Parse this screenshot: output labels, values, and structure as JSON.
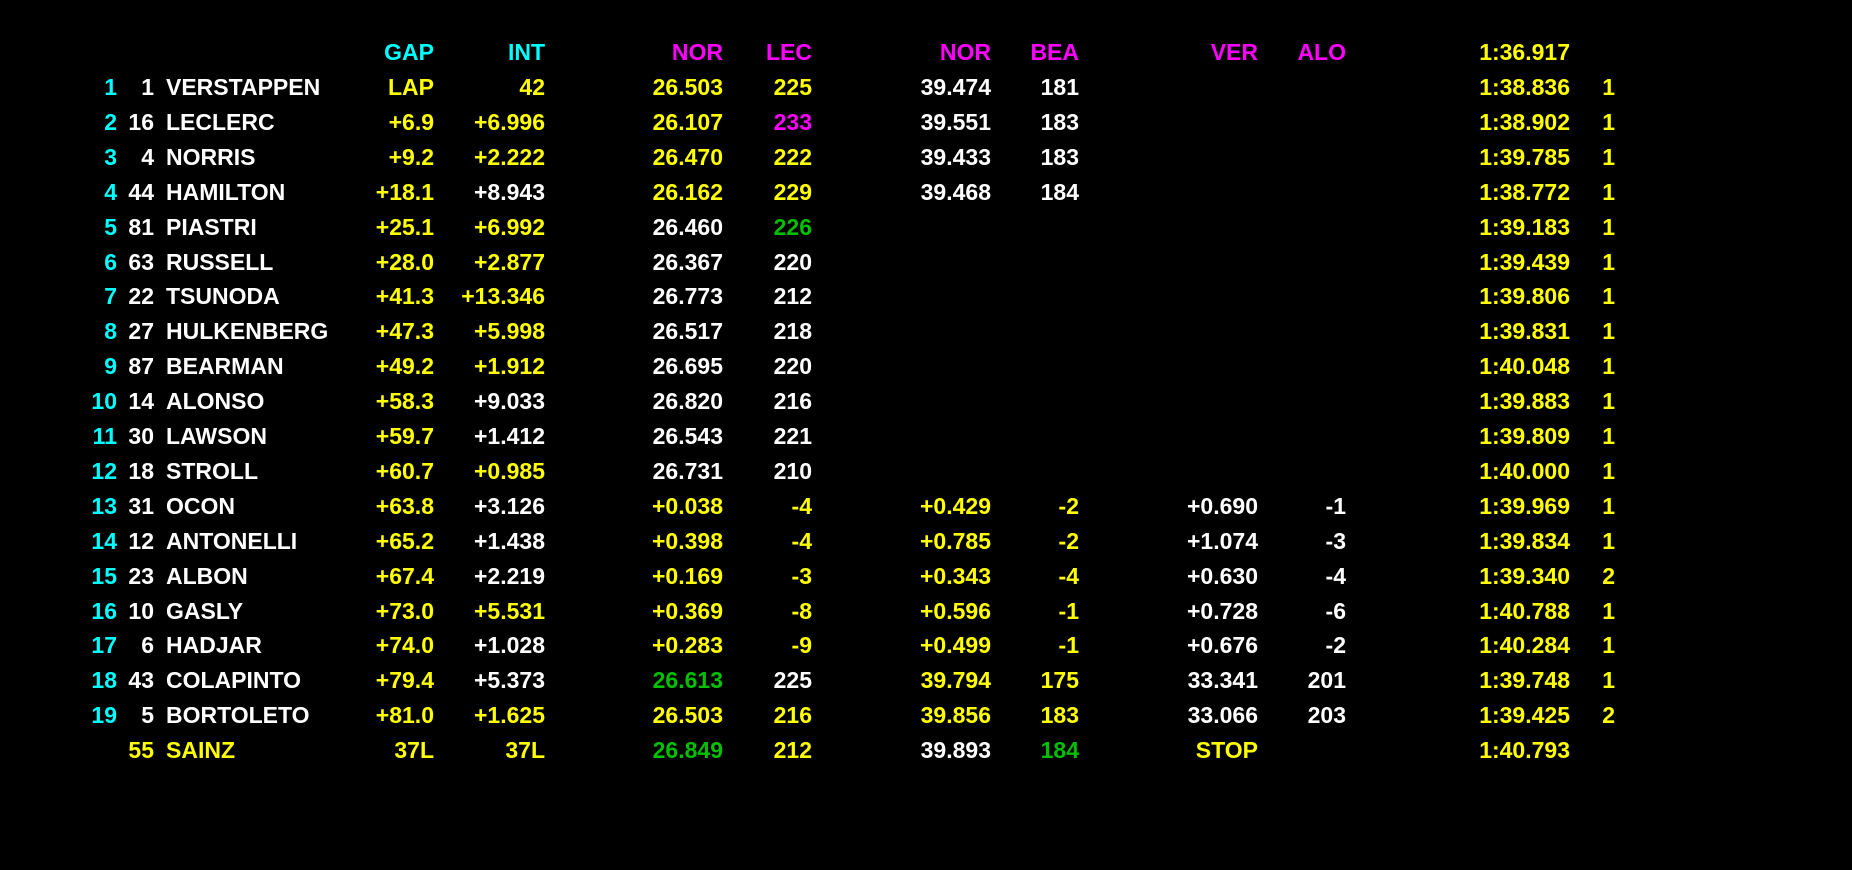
{
  "colors": {
    "white": "#ffffff",
    "yellow": "#ffff00",
    "cyan": "#00ffff",
    "magenta": "#ff00ff",
    "green": "#00c000"
  },
  "headers": [
    {
      "col": "gap",
      "text": "GAP",
      "color": "cyan"
    },
    {
      "col": "int",
      "text": "INT",
      "color": "cyan"
    },
    {
      "col": "s1",
      "text": "NOR",
      "color": "magenta"
    },
    {
      "col": "s1b",
      "text": "LEC",
      "color": "magenta"
    },
    {
      "col": "s2",
      "text": "NOR",
      "color": "magenta"
    },
    {
      "col": "s2b",
      "text": "BEA",
      "color": "magenta"
    },
    {
      "col": "s3",
      "text": "VER",
      "color": "magenta"
    },
    {
      "col": "s3b",
      "text": "ALO",
      "color": "magenta"
    },
    {
      "col": "best",
      "text": "1:36.917",
      "color": "yellow"
    }
  ],
  "rows": [
    {
      "pos": "1",
      "num": "1",
      "name": "VERSTAPPEN",
      "gap": [
        "LAP",
        "yellow"
      ],
      "int": [
        "42",
        "yellow"
      ],
      "s1": [
        "26.503",
        "yellow"
      ],
      "s1b": [
        "225",
        "yellow"
      ],
      "s2": [
        "39.474",
        "white"
      ],
      "s2b": [
        "181",
        "white"
      ],
      "s3": [
        "",
        ""
      ],
      "s3b": [
        "",
        ""
      ],
      "lap": [
        "1:38.836",
        "yellow"
      ],
      "pit": "1"
    },
    {
      "pos": "2",
      "num": "16",
      "name": "LECLERC",
      "gap": [
        "+6.9",
        "yellow"
      ],
      "int": [
        "+6.996",
        "yellow"
      ],
      "s1": [
        "26.107",
        "yellow"
      ],
      "s1b": [
        "233",
        "magenta"
      ],
      "s2": [
        "39.551",
        "white"
      ],
      "s2b": [
        "183",
        "white"
      ],
      "s3": [
        "",
        ""
      ],
      "s3b": [
        "",
        ""
      ],
      "lap": [
        "1:38.902",
        "yellow"
      ],
      "pit": "1"
    },
    {
      "pos": "3",
      "num": "4",
      "name": "NORRIS",
      "gap": [
        "+9.2",
        "yellow"
      ],
      "int": [
        "+2.222",
        "yellow"
      ],
      "s1": [
        "26.470",
        "yellow"
      ],
      "s1b": [
        "222",
        "yellow"
      ],
      "s2": [
        "39.433",
        "white"
      ],
      "s2b": [
        "183",
        "white"
      ],
      "s3": [
        "",
        ""
      ],
      "s3b": [
        "",
        ""
      ],
      "lap": [
        "1:39.785",
        "yellow"
      ],
      "pit": "1"
    },
    {
      "pos": "4",
      "num": "44",
      "name": "HAMILTON",
      "gap": [
        "+18.1",
        "yellow"
      ],
      "int": [
        "+8.943",
        "white"
      ],
      "s1": [
        "26.162",
        "yellow"
      ],
      "s1b": [
        "229",
        "yellow"
      ],
      "s2": [
        "39.468",
        "white"
      ],
      "s2b": [
        "184",
        "white"
      ],
      "s3": [
        "",
        ""
      ],
      "s3b": [
        "",
        ""
      ],
      "lap": [
        "1:38.772",
        "yellow"
      ],
      "pit": "1"
    },
    {
      "pos": "5",
      "num": "81",
      "name": "PIASTRI",
      "gap": [
        "+25.1",
        "yellow"
      ],
      "int": [
        "+6.992",
        "yellow"
      ],
      "s1": [
        "26.460",
        "white"
      ],
      "s1b": [
        "226",
        "green"
      ],
      "s2": [
        "",
        ""
      ],
      "s2b": [
        "",
        ""
      ],
      "s3": [
        "",
        ""
      ],
      "s3b": [
        "",
        ""
      ],
      "lap": [
        "1:39.183",
        "yellow"
      ],
      "pit": "1"
    },
    {
      "pos": "6",
      "num": "63",
      "name": "RUSSELL",
      "gap": [
        "+28.0",
        "yellow"
      ],
      "int": [
        "+2.877",
        "yellow"
      ],
      "s1": [
        "26.367",
        "white"
      ],
      "s1b": [
        "220",
        "white"
      ],
      "s2": [
        "",
        ""
      ],
      "s2b": [
        "",
        ""
      ],
      "s3": [
        "",
        ""
      ],
      "s3b": [
        "",
        ""
      ],
      "lap": [
        "1:39.439",
        "yellow"
      ],
      "pit": "1"
    },
    {
      "pos": "7",
      "num": "22",
      "name": "TSUNODA",
      "gap": [
        "+41.3",
        "yellow"
      ],
      "int": [
        "+13.346",
        "yellow"
      ],
      "s1": [
        "26.773",
        "white"
      ],
      "s1b": [
        "212",
        "white"
      ],
      "s2": [
        "",
        ""
      ],
      "s2b": [
        "",
        ""
      ],
      "s3": [
        "",
        ""
      ],
      "s3b": [
        "",
        ""
      ],
      "lap": [
        "1:39.806",
        "yellow"
      ],
      "pit": "1"
    },
    {
      "pos": "8",
      "num": "27",
      "name": "HULKENBERG",
      "gap": [
        "+47.3",
        "yellow"
      ],
      "int": [
        "+5.998",
        "yellow"
      ],
      "s1": [
        "26.517",
        "white"
      ],
      "s1b": [
        "218",
        "white"
      ],
      "s2": [
        "",
        ""
      ],
      "s2b": [
        "",
        ""
      ],
      "s3": [
        "",
        ""
      ],
      "s3b": [
        "",
        ""
      ],
      "lap": [
        "1:39.831",
        "yellow"
      ],
      "pit": "1"
    },
    {
      "pos": "9",
      "num": "87",
      "name": "BEARMAN",
      "gap": [
        "+49.2",
        "yellow"
      ],
      "int": [
        "+1.912",
        "yellow"
      ],
      "s1": [
        "26.695",
        "white"
      ],
      "s1b": [
        "220",
        "white"
      ],
      "s2": [
        "",
        ""
      ],
      "s2b": [
        "",
        ""
      ],
      "s3": [
        "",
        ""
      ],
      "s3b": [
        "",
        ""
      ],
      "lap": [
        "1:40.048",
        "yellow"
      ],
      "pit": "1"
    },
    {
      "pos": "10",
      "num": "14",
      "name": "ALONSO",
      "gap": [
        "+58.3",
        "yellow"
      ],
      "int": [
        "+9.033",
        "white"
      ],
      "s1": [
        "26.820",
        "white"
      ],
      "s1b": [
        "216",
        "white"
      ],
      "s2": [
        "",
        ""
      ],
      "s2b": [
        "",
        ""
      ],
      "s3": [
        "",
        ""
      ],
      "s3b": [
        "",
        ""
      ],
      "lap": [
        "1:39.883",
        "yellow"
      ],
      "pit": "1"
    },
    {
      "pos": "11",
      "num": "30",
      "name": "LAWSON",
      "gap": [
        "+59.7",
        "yellow"
      ],
      "int": [
        "+1.412",
        "white"
      ],
      "s1": [
        "26.543",
        "white"
      ],
      "s1b": [
        "221",
        "white"
      ],
      "s2": [
        "",
        ""
      ],
      "s2b": [
        "",
        ""
      ],
      "s3": [
        "",
        ""
      ],
      "s3b": [
        "",
        ""
      ],
      "lap": [
        "1:39.809",
        "yellow"
      ],
      "pit": "1"
    },
    {
      "pos": "12",
      "num": "18",
      "name": "STROLL",
      "gap": [
        "+60.7",
        "yellow"
      ],
      "int": [
        "+0.985",
        "yellow"
      ],
      "s1": [
        "26.731",
        "white"
      ],
      "s1b": [
        "210",
        "white"
      ],
      "s2": [
        "",
        ""
      ],
      "s2b": [
        "",
        ""
      ],
      "s3": [
        "",
        ""
      ],
      "s3b": [
        "",
        ""
      ],
      "lap": [
        "1:40.000",
        "yellow"
      ],
      "pit": "1"
    },
    {
      "pos": "13",
      "num": "31",
      "name": "OCON",
      "gap": [
        "+63.8",
        "yellow"
      ],
      "int": [
        "+3.126",
        "white"
      ],
      "s1": [
        "+0.038",
        "yellow"
      ],
      "s1b": [
        "-4",
        "yellow"
      ],
      "s2": [
        "+0.429",
        "yellow"
      ],
      "s2b": [
        "-2",
        "yellow"
      ],
      "s3": [
        "+0.690",
        "white"
      ],
      "s3b": [
        "-1",
        "white"
      ],
      "lap": [
        "1:39.969",
        "yellow"
      ],
      "pit": "1"
    },
    {
      "pos": "14",
      "num": "12",
      "name": "ANTONELLI",
      "gap": [
        "+65.2",
        "yellow"
      ],
      "int": [
        "+1.438",
        "white"
      ],
      "s1": [
        "+0.398",
        "yellow"
      ],
      "s1b": [
        "-4",
        "yellow"
      ],
      "s2": [
        "+0.785",
        "yellow"
      ],
      "s2b": [
        "-2",
        "yellow"
      ],
      "s3": [
        "+1.074",
        "white"
      ],
      "s3b": [
        "-3",
        "white"
      ],
      "lap": [
        "1:39.834",
        "yellow"
      ],
      "pit": "1"
    },
    {
      "pos": "15",
      "num": "23",
      "name": "ALBON",
      "gap": [
        "+67.4",
        "yellow"
      ],
      "int": [
        "+2.219",
        "white"
      ],
      "s1": [
        "+0.169",
        "yellow"
      ],
      "s1b": [
        "-3",
        "yellow"
      ],
      "s2": [
        "+0.343",
        "yellow"
      ],
      "s2b": [
        "-4",
        "yellow"
      ],
      "s3": [
        "+0.630",
        "white"
      ],
      "s3b": [
        "-4",
        "white"
      ],
      "lap": [
        "1:39.340",
        "yellow"
      ],
      "pit": "2"
    },
    {
      "pos": "16",
      "num": "10",
      "name": "GASLY",
      "gap": [
        "+73.0",
        "yellow"
      ],
      "int": [
        "+5.531",
        "yellow"
      ],
      "s1": [
        "+0.369",
        "yellow"
      ],
      "s1b": [
        "-8",
        "yellow"
      ],
      "s2": [
        "+0.596",
        "yellow"
      ],
      "s2b": [
        "-1",
        "yellow"
      ],
      "s3": [
        "+0.728",
        "white"
      ],
      "s3b": [
        "-6",
        "white"
      ],
      "lap": [
        "1:40.788",
        "yellow"
      ],
      "pit": "1"
    },
    {
      "pos": "17",
      "num": "6",
      "name": "HADJAR",
      "gap": [
        "+74.0",
        "yellow"
      ],
      "int": [
        "+1.028",
        "white"
      ],
      "s1": [
        "+0.283",
        "yellow"
      ],
      "s1b": [
        "-9",
        "yellow"
      ],
      "s2": [
        "+0.499",
        "yellow"
      ],
      "s2b": [
        "-1",
        "yellow"
      ],
      "s3": [
        "+0.676",
        "white"
      ],
      "s3b": [
        "-2",
        "white"
      ],
      "lap": [
        "1:40.284",
        "yellow"
      ],
      "pit": "1"
    },
    {
      "pos": "18",
      "num": "43",
      "name": "COLAPINTO",
      "gap": [
        "+79.4",
        "yellow"
      ],
      "int": [
        "+5.373",
        "white"
      ],
      "s1": [
        "26.613",
        "green"
      ],
      "s1b": [
        "225",
        "white"
      ],
      "s2": [
        "39.794",
        "yellow"
      ],
      "s2b": [
        "175",
        "yellow"
      ],
      "s3": [
        "33.341",
        "white"
      ],
      "s3b": [
        "201",
        "white"
      ],
      "lap": [
        "1:39.748",
        "yellow"
      ],
      "pit": "1"
    },
    {
      "pos": "19",
      "num": "5",
      "name": "BORTOLETO",
      "gap": [
        "+81.0",
        "yellow"
      ],
      "int": [
        "+1.625",
        "yellow"
      ],
      "s1": [
        "26.503",
        "yellow"
      ],
      "s1b": [
        "216",
        "yellow"
      ],
      "s2": [
        "39.856",
        "yellow"
      ],
      "s2b": [
        "183",
        "yellow"
      ],
      "s3": [
        "33.066",
        "white"
      ],
      "s3b": [
        "203",
        "white"
      ],
      "lap": [
        "1:39.425",
        "yellow"
      ],
      "pit": "2"
    },
    {
      "pos": "",
      "num": "55",
      "name": "SAINZ",
      "numColor": "yellow",
      "nameColor": "yellow",
      "gap": [
        "37L",
        "yellow"
      ],
      "int": [
        "37L",
        "yellow"
      ],
      "s1": [
        "26.849",
        "green"
      ],
      "s1b": [
        "212",
        "yellow"
      ],
      "s2": [
        "39.893",
        "white"
      ],
      "s2b": [
        "184",
        "green"
      ],
      "s3": [
        "STOP",
        "yellow"
      ],
      "s3b": [
        "",
        ""
      ],
      "lap": [
        "1:40.793",
        "yellow"
      ],
      "pit": ""
    }
  ]
}
